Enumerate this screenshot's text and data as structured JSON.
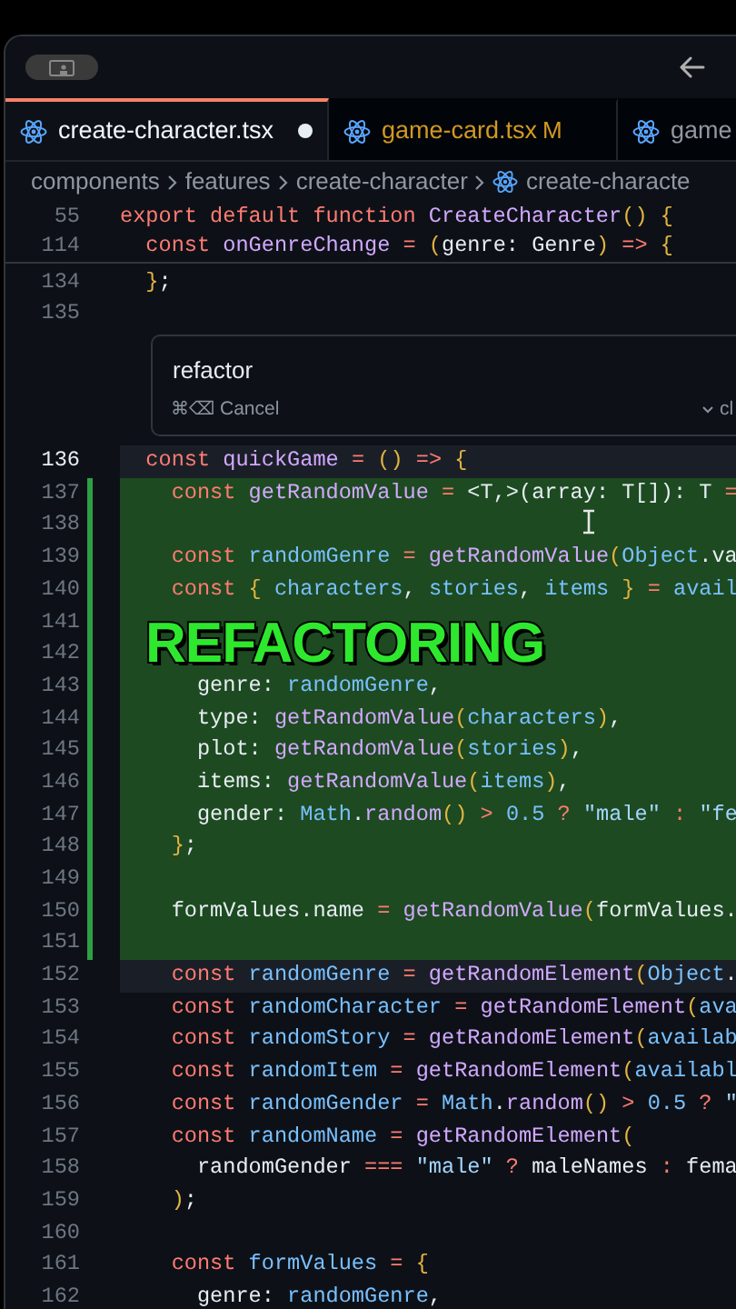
{
  "tabs": [
    {
      "label": "create-character.tsx",
      "selected": true,
      "unsaved": true
    },
    {
      "label": "game-card.tsx",
      "selected": false,
      "unsaved": false,
      "git_status": "M"
    },
    {
      "label": "game",
      "selected": false
    }
  ],
  "breadcrumb": [
    {
      "label": "components",
      "kind": "folder"
    },
    {
      "label": "features",
      "kind": "folder"
    },
    {
      "label": "create-character",
      "kind": "folder"
    },
    {
      "label": "create-characte",
      "kind": "file"
    }
  ],
  "sticky_lines": [
    {
      "number": "55",
      "code": [
        {
          "kind": "keyword",
          "text": "export default function "
        },
        {
          "kind": "function",
          "text": "CreateCharacter"
        },
        {
          "kind": "bracket",
          "text": "() {"
        }
      ]
    },
    {
      "number": "114",
      "code": [
        {
          "kind": "keyword",
          "text": "  const "
        },
        {
          "kind": "function",
          "text": "onGenreChange"
        },
        {
          "kind": "operator",
          "text": " = "
        },
        {
          "kind": "bracket",
          "text": "("
        },
        {
          "kind": "plain",
          "text": "genre: Genre"
        },
        {
          "kind": "bracket",
          "text": ")"
        },
        {
          "kind": "operator",
          "text": " => "
        },
        {
          "kind": "bracket",
          "text": "{"
        }
      ]
    }
  ],
  "lines_above": [
    {
      "number": "134",
      "active": false,
      "code": [
        {
          "kind": "bracket",
          "text": "  }"
        },
        {
          "kind": "plain",
          "text": ";"
        }
      ]
    },
    {
      "number": "135",
      "active": false
    }
  ],
  "inline_prompt": {
    "text": "refactor",
    "shortcut": "⌘⌫",
    "cancel": "Cancel",
    "option": "cl"
  },
  "lines": [
    {
      "number": "136",
      "kind": "highlighted",
      "active": true,
      "code": [
        {
          "kind": "keyword",
          "text": "  const "
        },
        {
          "kind": "function",
          "text": "quickGame"
        },
        {
          "kind": "operator",
          "text": " = "
        },
        {
          "kind": "bracket",
          "text": "()"
        },
        {
          "kind": "operator",
          "text": " => "
        },
        {
          "kind": "bracket",
          "text": "{"
        }
      ]
    },
    {
      "number": "137",
      "kind": "added",
      "active": false,
      "code": [
        {
          "kind": "keyword",
          "text": "    const "
        },
        {
          "kind": "function",
          "text": "getRandomValue"
        },
        {
          "kind": "operator",
          "text": " = "
        },
        {
          "kind": "plain",
          "text": "<T,>(array: T[]): T "
        },
        {
          "kind": "operator",
          "text": "="
        }
      ]
    },
    {
      "number": "138",
      "kind": "added",
      "active": false
    },
    {
      "number": "139",
      "kind": "added",
      "active": false,
      "code": [
        {
          "kind": "keyword",
          "text": "    const "
        },
        {
          "kind": "variable",
          "text": "randomGenre"
        },
        {
          "kind": "operator",
          "text": " = "
        },
        {
          "kind": "function",
          "text": "getRandomValue"
        },
        {
          "kind": "bracket",
          "text": "("
        },
        {
          "kind": "variable",
          "text": "Object"
        },
        {
          "kind": "plain",
          "text": ".va"
        }
      ]
    },
    {
      "number": "140",
      "kind": "added",
      "active": false,
      "code": [
        {
          "kind": "keyword",
          "text": "    const "
        },
        {
          "kind": "bracket",
          "text": "{ "
        },
        {
          "kind": "variable",
          "text": "characters"
        },
        {
          "kind": "plain",
          "text": ", "
        },
        {
          "kind": "variable",
          "text": "stories"
        },
        {
          "kind": "plain",
          "text": ", "
        },
        {
          "kind": "variable",
          "text": "items"
        },
        {
          "kind": "bracket",
          "text": " }"
        },
        {
          "kind": "operator",
          "text": " = "
        },
        {
          "kind": "variable",
          "text": "avail"
        }
      ]
    },
    {
      "number": "141",
      "kind": "added",
      "active": false
    },
    {
      "number": "142",
      "kind": "added",
      "active": false
    },
    {
      "number": "143",
      "kind": "added",
      "active": false,
      "code": [
        {
          "kind": "plain",
          "text": "      genre: "
        },
        {
          "kind": "variable",
          "text": "randomGenre"
        },
        {
          "kind": "plain",
          "text": ","
        }
      ]
    },
    {
      "number": "144",
      "kind": "added",
      "active": false,
      "code": [
        {
          "kind": "plain",
          "text": "      type: "
        },
        {
          "kind": "function",
          "text": "getRandomValue"
        },
        {
          "kind": "bracket",
          "text": "("
        },
        {
          "kind": "variable",
          "text": "characters"
        },
        {
          "kind": "bracket",
          "text": ")"
        },
        {
          "kind": "plain",
          "text": ","
        }
      ]
    },
    {
      "number": "145",
      "kind": "added",
      "active": false,
      "code": [
        {
          "kind": "plain",
          "text": "      plot: "
        },
        {
          "kind": "function",
          "text": "getRandomValue"
        },
        {
          "kind": "bracket",
          "text": "("
        },
        {
          "kind": "variable",
          "text": "stories"
        },
        {
          "kind": "bracket",
          "text": ")"
        },
        {
          "kind": "plain",
          "text": ","
        }
      ]
    },
    {
      "number": "146",
      "kind": "added",
      "active": false,
      "code": [
        {
          "kind": "plain",
          "text": "      items: "
        },
        {
          "kind": "function",
          "text": "getRandomValue"
        },
        {
          "kind": "bracket",
          "text": "("
        },
        {
          "kind": "variable",
          "text": "items"
        },
        {
          "kind": "bracket",
          "text": ")"
        },
        {
          "kind": "plain",
          "text": ","
        }
      ]
    },
    {
      "number": "147",
      "kind": "added",
      "active": false,
      "code": [
        {
          "kind": "plain",
          "text": "      gender: "
        },
        {
          "kind": "variable",
          "text": "Math"
        },
        {
          "kind": "plain",
          "text": "."
        },
        {
          "kind": "function",
          "text": "random"
        },
        {
          "kind": "bracket",
          "text": "()"
        },
        {
          "kind": "operator",
          "text": " > "
        },
        {
          "kind": "number",
          "text": "0.5"
        },
        {
          "kind": "operator",
          "text": " ? "
        },
        {
          "kind": "string",
          "text": "\"male\""
        },
        {
          "kind": "operator",
          "text": " : "
        },
        {
          "kind": "string",
          "text": "\"fe"
        }
      ]
    },
    {
      "number": "148",
      "kind": "added",
      "active": false,
      "code": [
        {
          "kind": "bracket",
          "text": "    }"
        },
        {
          "kind": "plain",
          "text": ";"
        }
      ]
    },
    {
      "number": "149",
      "kind": "added",
      "active": false
    },
    {
      "number": "150",
      "kind": "added",
      "active": false,
      "code": [
        {
          "kind": "plain",
          "text": "    formValues.name "
        },
        {
          "kind": "operator",
          "text": "= "
        },
        {
          "kind": "function",
          "text": "getRandomValue"
        },
        {
          "kind": "bracket",
          "text": "("
        },
        {
          "kind": "plain",
          "text": "formValues."
        }
      ]
    },
    {
      "number": "151",
      "kind": "added",
      "active": false
    },
    {
      "number": "152",
      "kind": "highlighted",
      "active": false,
      "code": [
        {
          "kind": "keyword",
          "text": "    const "
        },
        {
          "kind": "variable",
          "text": "randomGenre"
        },
        {
          "kind": "operator",
          "text": " = "
        },
        {
          "kind": "function",
          "text": "getRandomElement"
        },
        {
          "kind": "bracket",
          "text": "("
        },
        {
          "kind": "variable",
          "text": "Object"
        },
        {
          "kind": "plain",
          "text": "."
        }
      ]
    },
    {
      "number": "153",
      "kind": "normal",
      "active": false,
      "code": [
        {
          "kind": "keyword",
          "text": "    const "
        },
        {
          "kind": "variable",
          "text": "randomCharacter"
        },
        {
          "kind": "operator",
          "text": " = "
        },
        {
          "kind": "function",
          "text": "getRandomElement"
        },
        {
          "kind": "bracket",
          "text": "("
        },
        {
          "kind": "variable",
          "text": "ava"
        }
      ]
    },
    {
      "number": "154",
      "kind": "normal",
      "active": false,
      "code": [
        {
          "kind": "keyword",
          "text": "    const "
        },
        {
          "kind": "variable",
          "text": "randomStory"
        },
        {
          "kind": "operator",
          "text": " = "
        },
        {
          "kind": "function",
          "text": "getRandomElement"
        },
        {
          "kind": "bracket",
          "text": "("
        },
        {
          "kind": "variable",
          "text": "availab"
        }
      ]
    },
    {
      "number": "155",
      "kind": "normal",
      "active": false,
      "code": [
        {
          "kind": "keyword",
          "text": "    const "
        },
        {
          "kind": "variable",
          "text": "randomItem"
        },
        {
          "kind": "operator",
          "text": " = "
        },
        {
          "kind": "function",
          "text": "getRandomElement"
        },
        {
          "kind": "bracket",
          "text": "("
        },
        {
          "kind": "variable",
          "text": "availabl"
        }
      ]
    },
    {
      "number": "156",
      "kind": "normal",
      "active": false,
      "code": [
        {
          "kind": "keyword",
          "text": "    const "
        },
        {
          "kind": "variable",
          "text": "randomGender"
        },
        {
          "kind": "operator",
          "text": " = "
        },
        {
          "kind": "variable",
          "text": "Math"
        },
        {
          "kind": "plain",
          "text": "."
        },
        {
          "kind": "function",
          "text": "random"
        },
        {
          "kind": "bracket",
          "text": "()"
        },
        {
          "kind": "operator",
          "text": " > "
        },
        {
          "kind": "number",
          "text": "0.5"
        },
        {
          "kind": "operator",
          "text": " ? "
        },
        {
          "kind": "string",
          "text": "\""
        }
      ]
    },
    {
      "number": "157",
      "kind": "normal",
      "active": false,
      "code": [
        {
          "kind": "keyword",
          "text": "    const "
        },
        {
          "kind": "variable",
          "text": "randomName"
        },
        {
          "kind": "operator",
          "text": " = "
        },
        {
          "kind": "function",
          "text": "getRandomElement"
        },
        {
          "kind": "bracket",
          "text": "("
        }
      ]
    },
    {
      "number": "158",
      "kind": "normal",
      "active": false,
      "code": [
        {
          "kind": "plain",
          "text": "      randomGender "
        },
        {
          "kind": "operator",
          "text": "=== "
        },
        {
          "kind": "string",
          "text": "\"male\""
        },
        {
          "kind": "operator",
          "text": " ? "
        },
        {
          "kind": "plain",
          "text": "maleNames "
        },
        {
          "kind": "operator",
          "text": ": "
        },
        {
          "kind": "plain",
          "text": "fema"
        }
      ]
    },
    {
      "number": "159",
      "kind": "normal",
      "active": false,
      "code": [
        {
          "kind": "bracket",
          "text": "    )"
        },
        {
          "kind": "plain",
          "text": ";"
        }
      ]
    },
    {
      "number": "160",
      "kind": "normal",
      "active": false
    },
    {
      "number": "161",
      "kind": "normal",
      "active": false,
      "code": [
        {
          "kind": "keyword",
          "text": "    const "
        },
        {
          "kind": "variable",
          "text": "formValues"
        },
        {
          "kind": "operator",
          "text": " = "
        },
        {
          "kind": "bracket",
          "text": "{"
        }
      ]
    },
    {
      "number": "162",
      "kind": "normal",
      "active": false,
      "code": [
        {
          "kind": "plain",
          "text": "      genre: "
        },
        {
          "kind": "variable",
          "text": "randomGenre"
        },
        {
          "kind": "plain",
          "text": ","
        }
      ]
    }
  ],
  "caption": "REFACTORING"
}
